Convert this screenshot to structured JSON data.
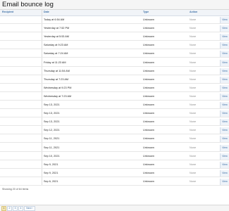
{
  "page": {
    "title": "Email bounce log"
  },
  "table": {
    "columns": {
      "recipient": "Recipient",
      "date": "Date",
      "type": "Type",
      "action": "Action"
    },
    "view_label": "View",
    "rows": [
      {
        "date": "Today at 6:54 AM",
        "type": "Unknown",
        "action": "None"
      },
      {
        "date": "Yesterday at 7:52 PM",
        "type": "Unknown",
        "action": "None"
      },
      {
        "date": "Yesterday at 5:53 AM",
        "type": "Unknown",
        "action": "None"
      },
      {
        "date": "Saturday at 9:23 AM",
        "type": "Unknown",
        "action": "None"
      },
      {
        "date": "Saturday at 7:24 AM",
        "type": "Unknown",
        "action": "None"
      },
      {
        "date": "Friday at 11:23 AM",
        "type": "Unknown",
        "action": "None"
      },
      {
        "date": "Thursday at 11:54 AM",
        "type": "Unknown",
        "action": "None"
      },
      {
        "date": "Thursday at 7:23 AM",
        "type": "Unknown",
        "action": "None"
      },
      {
        "date": "Wednesday at 9:23 PM",
        "type": "Unknown",
        "action": "None"
      },
      {
        "date": "Wednesday at 7:23 AM",
        "type": "Unknown",
        "action": "None"
      },
      {
        "date": "Sep 13, 2021",
        "type": "Unknown",
        "action": "None"
      },
      {
        "date": "Sep 13, 2021",
        "type": "Unknown",
        "action": "None"
      },
      {
        "date": "Sep 13, 2021",
        "type": "Unknown",
        "action": "None"
      },
      {
        "date": "Sep 12, 2021",
        "type": "Unknown",
        "action": "None"
      },
      {
        "date": "Sep 11, 2021",
        "type": "Unknown",
        "action": "None"
      },
      {
        "date": "Sep 11, 2021",
        "type": "Unknown",
        "action": "None"
      },
      {
        "date": "Sep 10, 2021",
        "type": "Unknown",
        "action": "None"
      },
      {
        "date": "Sep 9, 2021",
        "type": "Unknown",
        "action": "None"
      },
      {
        "date": "Sep 9, 2021",
        "type": "Unknown",
        "action": "None"
      },
      {
        "date": "Sep 6, 2021",
        "type": "Unknown",
        "action": "None"
      }
    ],
    "footer": "Showing 20 of 64 items"
  },
  "pagination": {
    "pages": [
      "1",
      "2",
      "3",
      "4"
    ],
    "current": "1",
    "next_label": "Next ›"
  }
}
